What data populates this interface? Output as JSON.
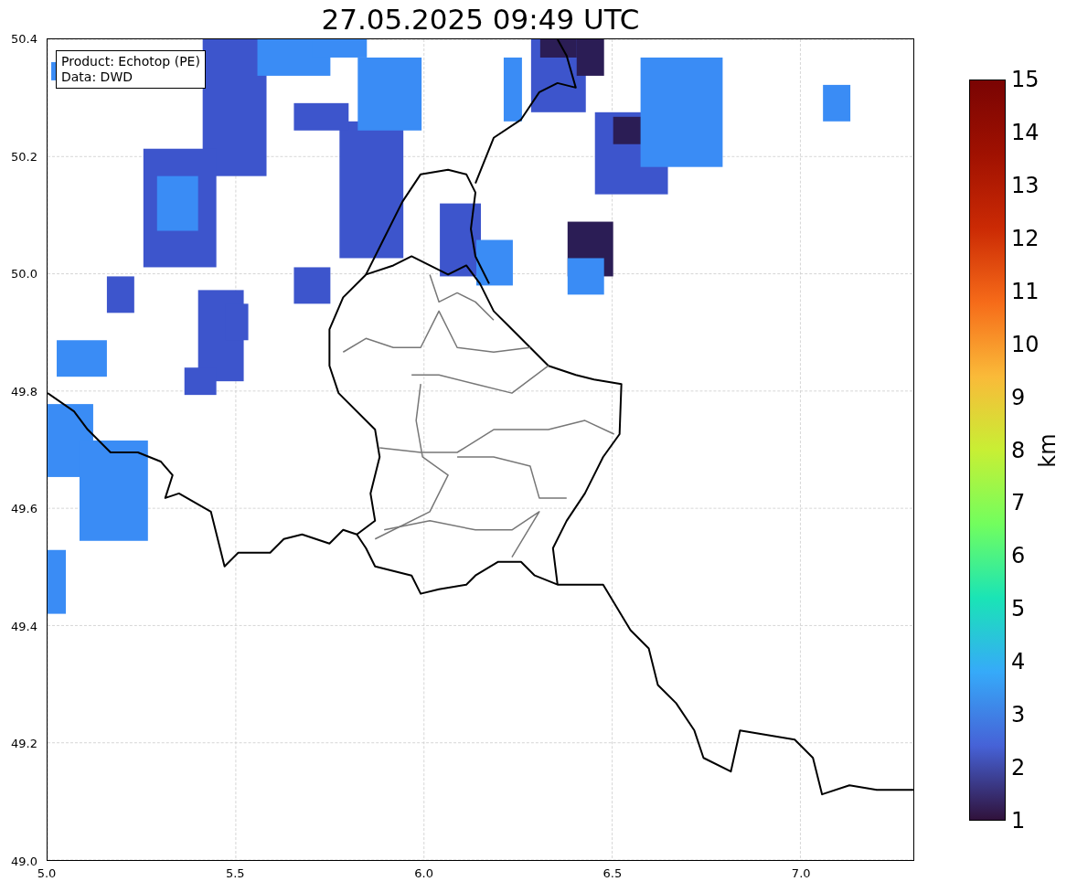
{
  "title": "27.05.2025 09:49 UTC",
  "info_box": [
    "Product: Echotop (PE)",
    "Data: DWD"
  ],
  "map": {
    "xticks": [
      "5.0",
      "5.5",
      "6.0",
      "6.5",
      "7.0"
    ],
    "yticks": [
      "50.4",
      "50.2",
      "50.0",
      "49.8",
      "49.6",
      "49.4",
      "49.2",
      "49.0"
    ]
  },
  "colorbar": {
    "label": "km",
    "ticks": [
      "15",
      "14",
      "13",
      "12",
      "11",
      "10",
      "9",
      "8",
      "7",
      "6",
      "5",
      "4",
      "3",
      "2",
      "1"
    ]
  }
}
